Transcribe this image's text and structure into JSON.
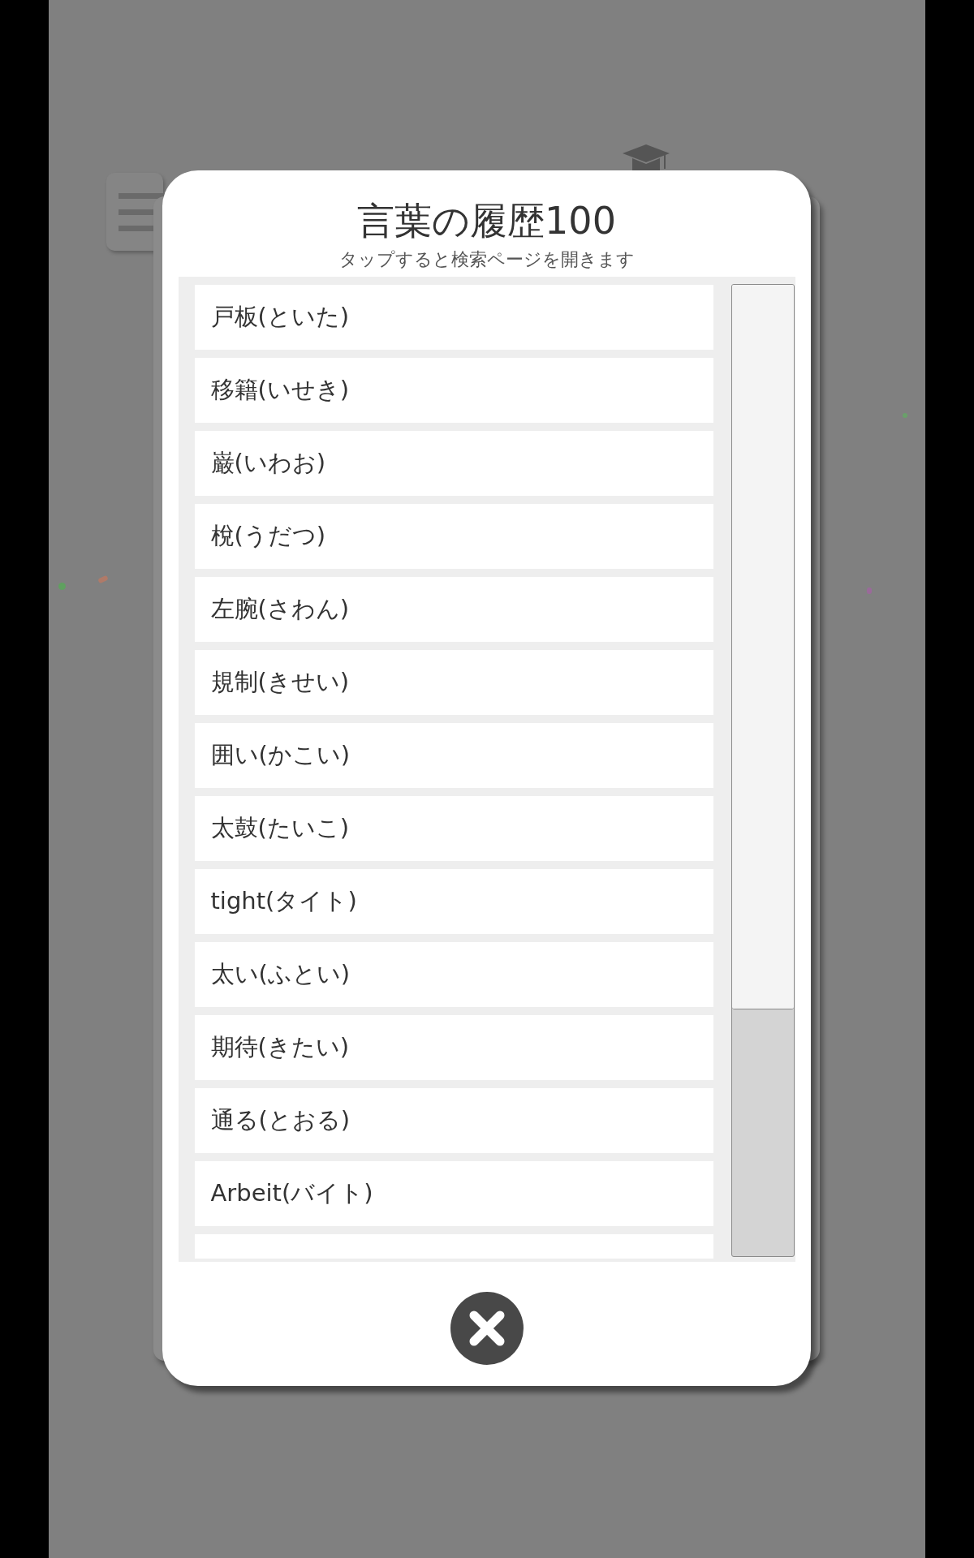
{
  "dialog": {
    "title": "言葉の履歴100",
    "subtitle": "タップすると検索ページを開きます",
    "items": [
      {
        "label": "戸板(といた)"
      },
      {
        "label": "移籍(いせき)"
      },
      {
        "label": "巌(いわお)"
      },
      {
        "label": "梲(うだつ)"
      },
      {
        "label": "左腕(さわん)"
      },
      {
        "label": "規制(きせい)"
      },
      {
        "label": "囲い(かこい)"
      },
      {
        "label": "太鼓(たいこ)"
      },
      {
        "label": "tight(タイト)"
      },
      {
        "label": "太い(ふとい)"
      },
      {
        "label": "期待(きたい)"
      },
      {
        "label": "通る(とおる)"
      },
      {
        "label": "Arbeit(バイト)"
      }
    ],
    "more_below": true
  }
}
